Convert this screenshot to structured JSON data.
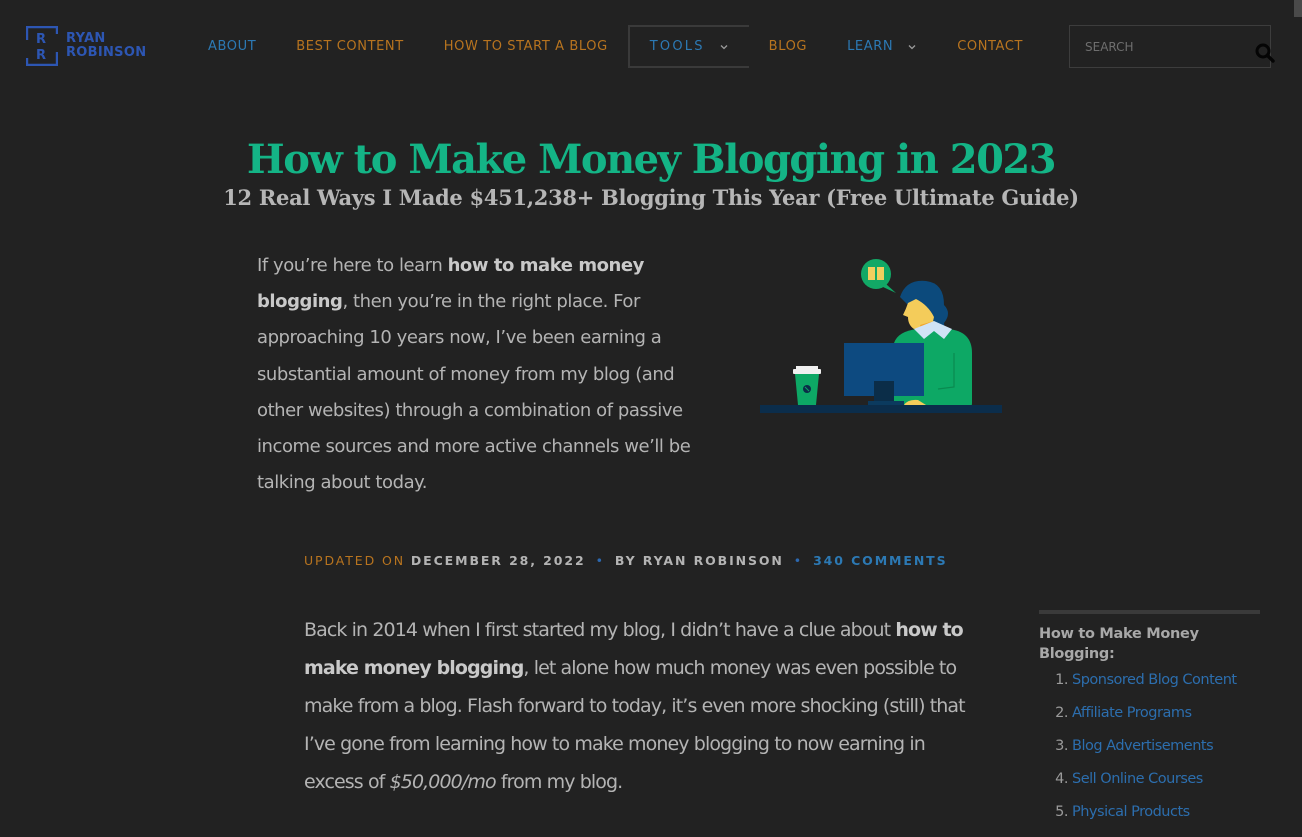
{
  "header": {
    "logo": {
      "line1": "RYAN",
      "line2": "ROBINSON",
      "mark_letter": "R",
      "color": "#2d56b3"
    },
    "nav": [
      {
        "label": "ABOUT",
        "color": "blue",
        "has_dropdown": false
      },
      {
        "label": "BEST CONTENT",
        "color": "orange",
        "has_dropdown": false
      },
      {
        "label": "HOW TO START A BLOG",
        "color": "orange",
        "has_dropdown": false
      },
      {
        "label": "TOOLS",
        "color": "blue",
        "has_dropdown": true,
        "active": true
      },
      {
        "label": "BLOG",
        "color": "orange",
        "has_dropdown": false
      },
      {
        "label": "LEARN",
        "color": "blue",
        "has_dropdown": true
      },
      {
        "label": "CONTACT",
        "color": "orange",
        "has_dropdown": false
      }
    ],
    "search": {
      "placeholder": "SEARCH",
      "value": "",
      "icon": "search-icon"
    }
  },
  "article": {
    "title": "How to Make Money Blogging in 2023",
    "subtitle": "12 Real Ways I Made $451,238+ Blogging This Year (Free Ultimate Guide)",
    "intro": {
      "before_bold": "If you’re here to learn ",
      "bold": "how to make money blogging",
      "after_bold": ", then you’re in the right place. For approaching 10 years now, I’ve been earning a substantial amount of money from my blog (and other websites) through a combination of passive income sources and more active channels we’ll be talking about today."
    },
    "illustration": "person-at-computer-illustration",
    "meta": {
      "updated_label": "UPDATED ON",
      "date": "DECEMBER 28, 2022",
      "separator": "•",
      "author": "BY RYAN ROBINSON",
      "comments": "340 COMMENTS"
    },
    "body": {
      "before_bold": "Back in 2014 when I first started my blog, I didn’t have a clue about ",
      "bold": "how to make money blogging",
      "middle": ", let alone how much money was even possible to make from a blog. Flash forward to today, it’s even more shocking (still) that I’ve gone from learning how to make money blogging to now earning in excess of ",
      "italic": "$50,000/mo",
      "after": " from my blog."
    }
  },
  "toc": {
    "title": "How to Make Money Blogging:",
    "items": [
      {
        "num": "1.",
        "label": "Sponsored Blog Content"
      },
      {
        "num": "2.",
        "label": "Affiliate Programs"
      },
      {
        "num": "3.",
        "label": "Blog Advertisements"
      },
      {
        "num": "4.",
        "label": "Sell Online Courses"
      },
      {
        "num": "5.",
        "label": "Physical Products"
      }
    ]
  },
  "colors": {
    "background": "#222222",
    "accent_green": "#14b486",
    "nav_orange": "#b8741f",
    "nav_blue": "#2c79b4",
    "link_blue": "#2c6eae",
    "logo_blue": "#2d56b3"
  }
}
